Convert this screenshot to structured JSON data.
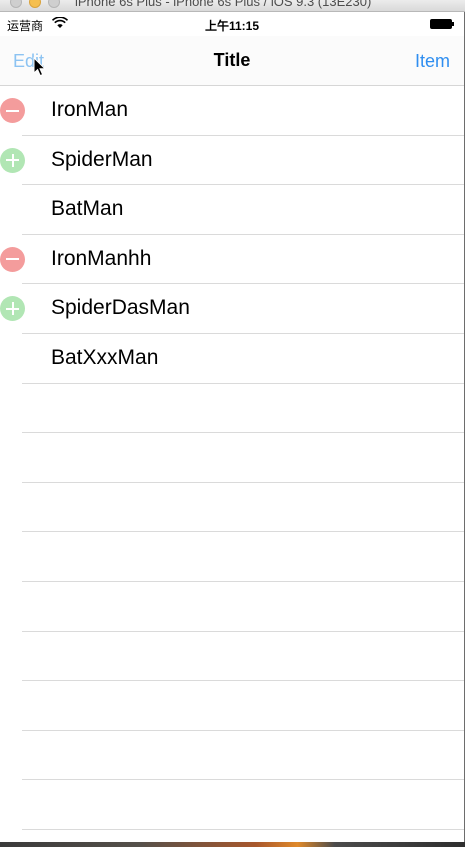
{
  "window": {
    "title": "iPhone 6s Plus - iPhone 6s Plus / iOS 9.3 (13E230)"
  },
  "statusbar": {
    "carrier": "运营商",
    "time": "上午11:15",
    "wifi_icon": "wifi-icon",
    "battery_icon": "battery-icon"
  },
  "navbar": {
    "edit_label": "Edit",
    "title": "Title",
    "item_label": "Item"
  },
  "colors": {
    "tint": "#2f8ef0",
    "delete": "#f49c9c",
    "insert": "#b1e6b4"
  },
  "table": {
    "rows": [
      {
        "label": "IronMan",
        "control": "delete"
      },
      {
        "label": "SpiderMan",
        "control": "insert"
      },
      {
        "label": "BatMan",
        "control": "none"
      },
      {
        "label": "IronManhh",
        "control": "delete"
      },
      {
        "label": "SpiderDasMan",
        "control": "insert"
      },
      {
        "label": "BatXxxMan",
        "control": "none"
      }
    ]
  }
}
